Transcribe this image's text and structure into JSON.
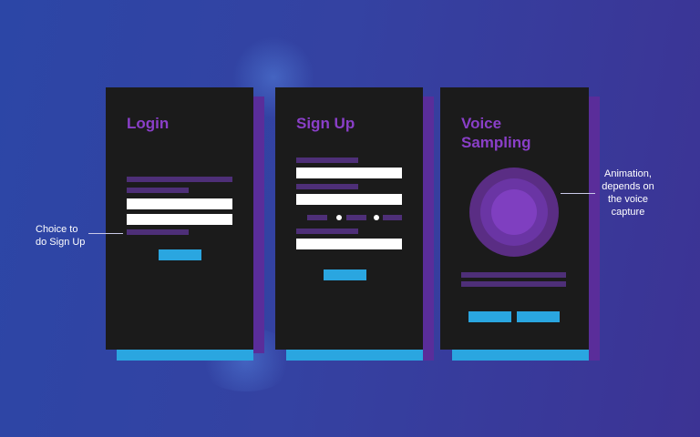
{
  "screens": {
    "login": {
      "title": "Login"
    },
    "signup": {
      "title": "Sign Up"
    },
    "voice": {
      "title": "Voice Sampling"
    }
  },
  "annotations": {
    "signup_choice": [
      "Choice to",
      "do Sign Up"
    ],
    "animation": [
      "Animation,",
      "depends on",
      "the voice",
      "capture"
    ]
  },
  "colors": {
    "background": "#3442a2",
    "card": "#1b1b1b",
    "title": "#8a3fc8",
    "placeholder_bar": "#4e2f78",
    "input": "#ffffff",
    "button": "#2aa6e0",
    "shadow": "#5a2d9a"
  }
}
